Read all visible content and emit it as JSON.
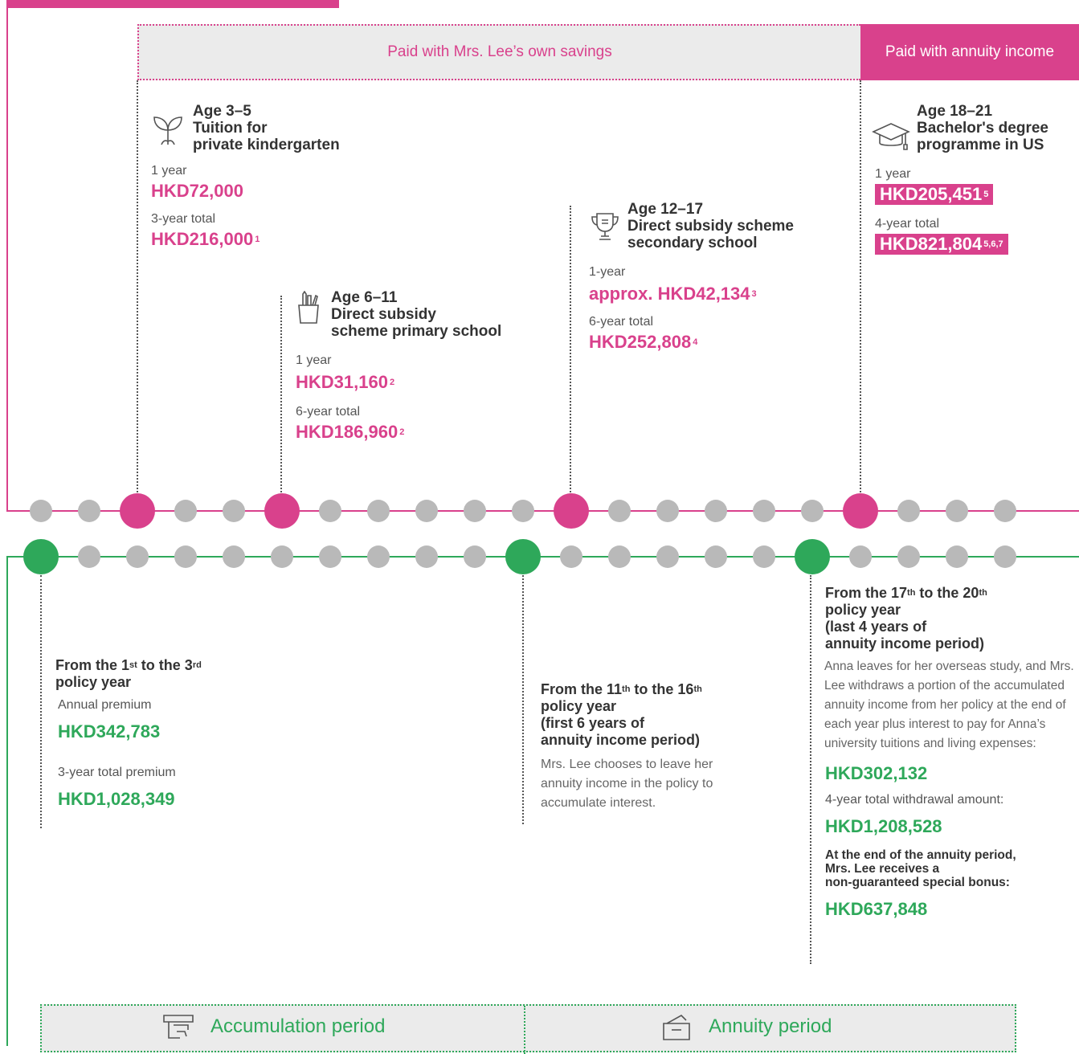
{
  "banner": {
    "own_savings": "Paid with Mrs. Lee’s own savings",
    "annuity_income": "Paid with annuity income"
  },
  "colors": {
    "pink": "#d9418c",
    "green": "#2ea85a",
    "grey_dot": "#b9b9b9",
    "band": "#ebebeb"
  },
  "stages": {
    "kindergarten": {
      "icon": "sprout-icon",
      "age": "Age 3–5",
      "title1": "Tuition for",
      "title2": "private kindergarten",
      "label1": "1 year",
      "amount1": "HKD72,000",
      "label2": "3-year total",
      "amount2": "HKD216,000",
      "amount2_note": "1"
    },
    "primary": {
      "icon": "pencil-cup-icon",
      "age": "Age 6–11",
      "title1": "Direct subsidy",
      "title2": "scheme primary school",
      "label1": "1 year",
      "amount1": "HKD31,160",
      "amount1_note": "2",
      "label2": "6-year total",
      "amount2": "HKD186,960",
      "amount2_note": "2"
    },
    "secondary": {
      "icon": "trophy-icon",
      "age": "Age 12–17",
      "title1": "Direct subsidy scheme",
      "title2": "secondary school",
      "label1": "1-year",
      "amount1": "approx. HKD42,134",
      "amount1_note": "3",
      "label2": "6-year total",
      "amount2": "HKD252,808",
      "amount2_note": "4"
    },
    "university": {
      "icon": "graduation-cap-icon",
      "age": "Age 18–21",
      "title1": "Bachelor's degree",
      "title2": "programme in US",
      "label1": "1 year",
      "amount1": "HKD205,451",
      "amount1_note": "5",
      "label2": "4-year total",
      "amount2": "HKD821,804",
      "amount2_note": "5,6,7"
    }
  },
  "policy": {
    "p1": {
      "title_a": "From the 1",
      "sup_a": "st",
      "title_b": " to the 3",
      "sup_b": "rd",
      "title_c": "policy year",
      "label1": "Annual premium",
      "amount1": "HKD342,783",
      "label2": "3-year total premium",
      "amount2": "HKD1,028,349"
    },
    "p2": {
      "title_a": "From the 11",
      "sup_a": "th",
      "title_b": " to the 16",
      "sup_b": "th",
      "title_c": "policy year",
      "title_d": "(first 6 years of",
      "title_e": "annuity income period)",
      "text": "Mrs. Lee chooses to leave her annuity income in the policy to accumulate interest."
    },
    "p3": {
      "title_a": "From the 17",
      "sup_a": "th",
      "title_b": " to the 20",
      "sup_b": "th",
      "title_c": "policy year",
      "title_d": "(last 4 years of",
      "title_e": "annuity income period)",
      "text": "Anna leaves for her overseas study, and Mrs. Lee withdraws a portion of the accumulated annuity income from her policy at the end of each year plus interest to pay for Anna’s university tuitions and living expenses:",
      "amount1": "HKD302,132",
      "label2": "4-year total withdrawal amount:",
      "amount2": "HKD1,208,528",
      "bonus_text1": "At the end of the annuity period,",
      "bonus_text2": "Mrs. Lee receives a",
      "bonus_text3": "non-guaranteed special bonus:",
      "amount3": "HKD637,848"
    }
  },
  "periods": {
    "accumulation": {
      "icon": "atm-card-icon",
      "label": "Accumulation period"
    },
    "annuity": {
      "icon": "envelope-hand-icon",
      "label": "Annuity period"
    }
  }
}
